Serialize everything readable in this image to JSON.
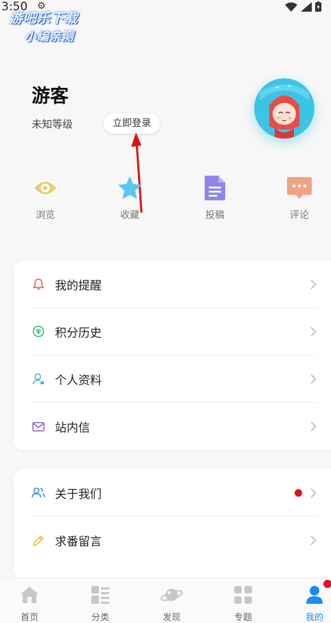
{
  "status": {
    "time": "3:50",
    "gear": "⚙"
  },
  "watermark": {
    "line1": "游吧乐下载",
    "line2": "小编亲测"
  },
  "profile": {
    "name": "游客",
    "level": "未知等级",
    "login_label": "立即登录"
  },
  "quick": [
    {
      "label": "浏览",
      "icon": "eye-icon"
    },
    {
      "label": "收藏",
      "icon": "star-icon"
    },
    {
      "label": "投稿",
      "icon": "document-icon"
    },
    {
      "label": "评论",
      "icon": "comment-icon"
    }
  ],
  "menu1": [
    {
      "label": "我的提醒",
      "icon": "bell-icon"
    },
    {
      "label": "积分历史",
      "icon": "points-icon"
    },
    {
      "label": "个人资料",
      "icon": "user-icon"
    },
    {
      "label": "站内信",
      "icon": "mail-icon"
    }
  ],
  "menu2": [
    {
      "label": "关于我们",
      "icon": "group-icon",
      "has_dot": true
    },
    {
      "label": "求番留言",
      "icon": "pencil-icon"
    }
  ],
  "tabs": [
    {
      "label": "首页",
      "icon": "home-icon"
    },
    {
      "label": "分类",
      "icon": "category-icon"
    },
    {
      "label": "发现",
      "icon": "planet-icon"
    },
    {
      "label": "专题",
      "icon": "grid-icon"
    },
    {
      "label": "我的",
      "icon": "profile-icon",
      "active": true
    }
  ],
  "colors": {
    "accent": "#1a8cf0",
    "badge": "#e0101f",
    "arrow": "#e01010"
  }
}
